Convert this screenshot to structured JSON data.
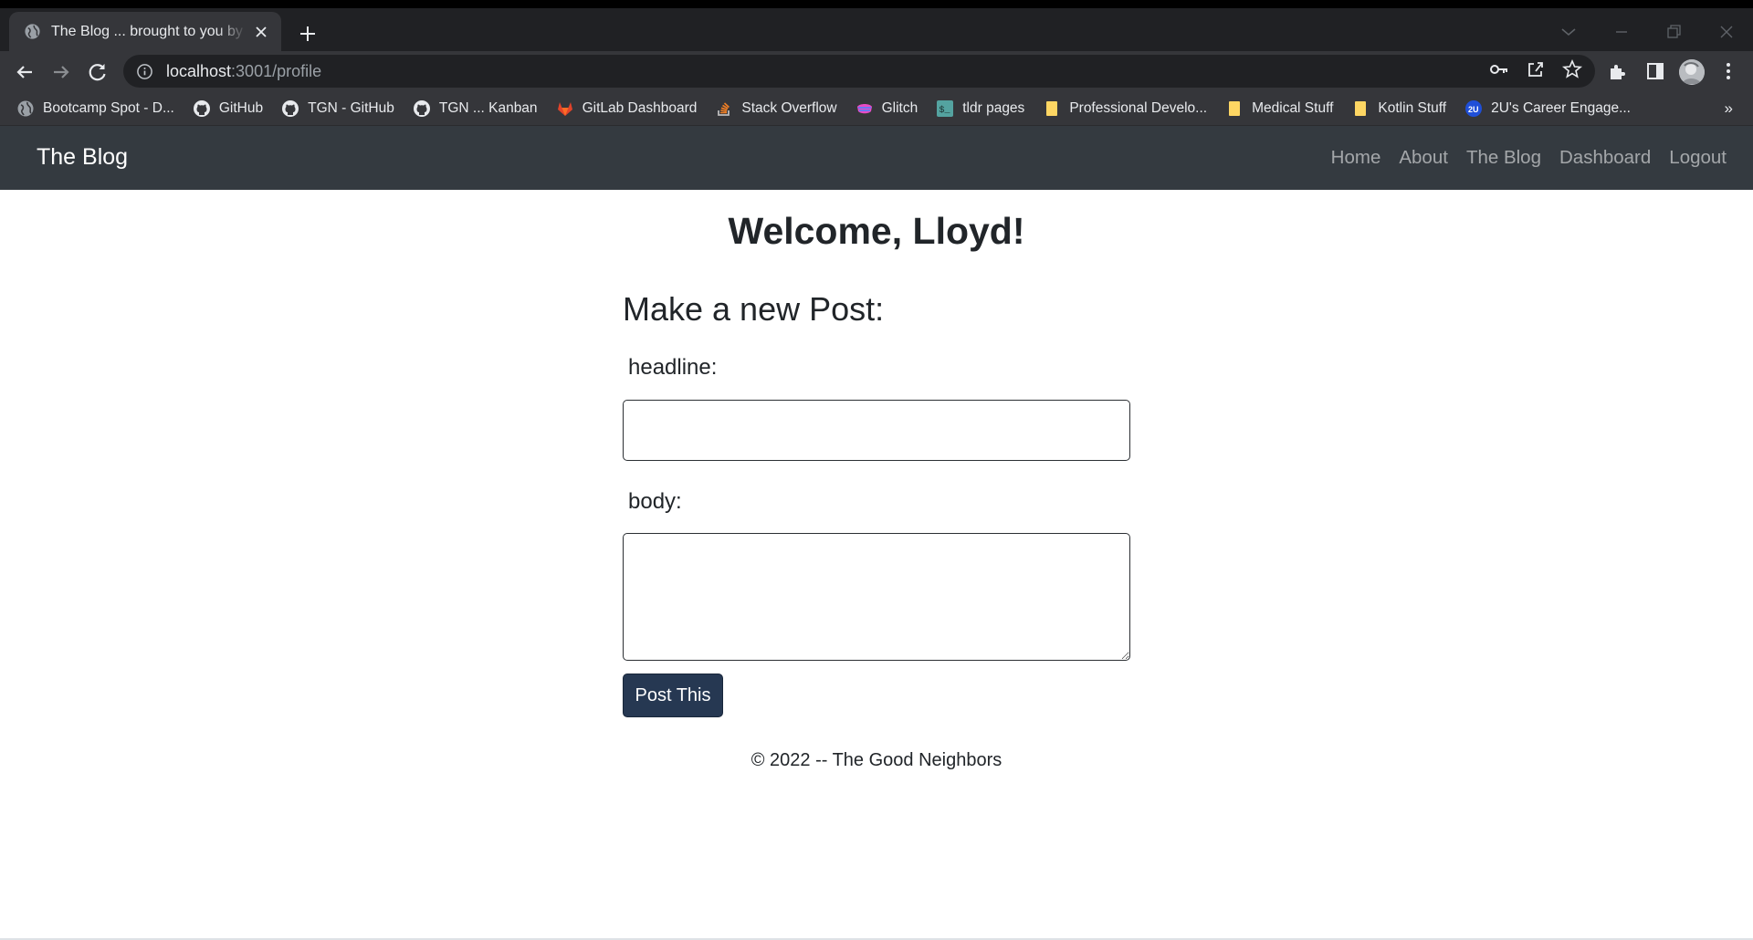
{
  "browser": {
    "tab": {
      "title": "The Blog ... brought to you by the Good Neighbors"
    },
    "address": {
      "host": "localhost",
      "path": ":3001/profile"
    },
    "bookmarks": [
      {
        "label": "Bootcamp Spot - D...",
        "icon": "globe-icon"
      },
      {
        "label": "GitHub",
        "icon": "github-icon"
      },
      {
        "label": "TGN - GitHub",
        "icon": "github-icon"
      },
      {
        "label": "TGN ... Kanban",
        "icon": "github-icon"
      },
      {
        "label": "GitLab Dashboard",
        "icon": "gitlab-icon"
      },
      {
        "label": "Stack Overflow",
        "icon": "stackoverflow-icon"
      },
      {
        "label": "Glitch",
        "icon": "glitch-icon"
      },
      {
        "label": "tldr pages",
        "icon": "tldr-icon"
      },
      {
        "label": "Professional Develo...",
        "icon": "folder-icon"
      },
      {
        "label": "Medical Stuff",
        "icon": "folder-icon"
      },
      {
        "label": "Kotlin Stuff",
        "icon": "folder-icon"
      },
      {
        "label": "2U's Career Engage...",
        "icon": "2u-icon"
      }
    ],
    "bookmarks_overflow": "»"
  },
  "site": {
    "brand": "The Blog",
    "nav": {
      "home": "Home",
      "about": "About",
      "blog": "The Blog",
      "dashboard": "Dashboard",
      "logout": "Logout"
    },
    "welcome": "Welcome, Lloyd!",
    "form": {
      "title": "Make a new Post:",
      "headline_label": "headline:",
      "headline_value": "",
      "body_label": "body:",
      "body_value": "",
      "submit_label": "Post This"
    },
    "footer": "© 2022 -- The Good Neighbors"
  },
  "colors": {
    "navbar_bg": "#343a40",
    "button_bg": "#263852",
    "chrome_bg": "#35363a"
  }
}
